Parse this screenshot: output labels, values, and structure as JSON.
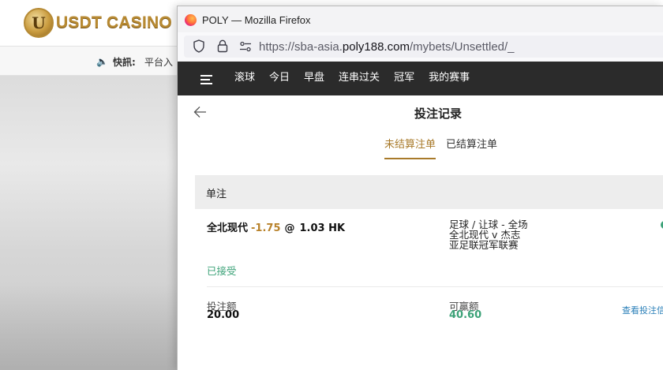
{
  "background": {
    "logo_text": "USDT CASINO",
    "logo_mark": "U",
    "ticker_label": "快訊:",
    "ticker_text": "平台入"
  },
  "browser": {
    "title": "POLY — Mozilla Firefox",
    "url_prefix": "https://sba-asia.",
    "url_host": "poly188.com",
    "url_path": "/mybets/Unsettled/_"
  },
  "nav": {
    "items": [
      "滚球",
      "今日",
      "早盘",
      "连串过关",
      "冠军",
      "我的赛事"
    ]
  },
  "page": {
    "title": "投注记录",
    "tabs": [
      {
        "label": "未结算注单",
        "active": true
      },
      {
        "label": "已结算注单",
        "active": false
      }
    ]
  },
  "bets": {
    "section_label": "单注",
    "selection": "全北现代",
    "handicap": "-1.75",
    "at": "@",
    "odds": "1.03 HK",
    "market": "足球 / 让球 - 全场",
    "match": "全北现代 v 杰志",
    "league": "亚足联冠军联赛",
    "status": "已接受",
    "stake_label": "投注额",
    "stake": "20.00",
    "win_label": "可赢额",
    "win": "40.60",
    "details_link": "查看投注信"
  },
  "colors": {
    "accent": "#a87a2a",
    "handicap": "#b8822b",
    "positive": "#3ca278",
    "nav_bg": "#2b2b2b",
    "link": "#2a7fb8"
  }
}
